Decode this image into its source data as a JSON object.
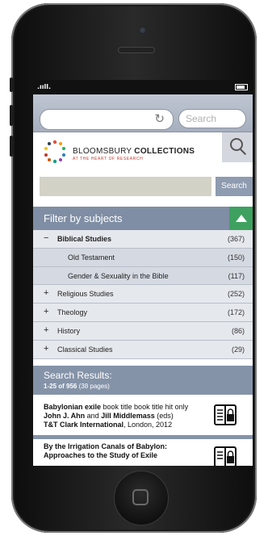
{
  "browser": {
    "search_placeholder": "Search"
  },
  "header": {
    "logo_name_plain": "BLOOMSBURY ",
    "logo_name_bold": "COLLECTIONS",
    "logo_tagline": "AT THE HEART OF RESEARCH",
    "search_button": "Search"
  },
  "filter": {
    "title": "Filter by subjects",
    "subjects": [
      {
        "sign": "−",
        "name": "Biblical Studies",
        "count": "(367)"
      },
      {
        "sign": "",
        "name": "Old Testament",
        "count": "(150)"
      },
      {
        "sign": "",
        "name": "Gender & Sexuality in the Bible",
        "count": "(117)"
      },
      {
        "sign": "+",
        "name": "Religious Studies",
        "count": "(252)"
      },
      {
        "sign": "+",
        "name": "Theology",
        "count": "(172)"
      },
      {
        "sign": "+",
        "name": "History",
        "count": "(86)"
      },
      {
        "sign": "+",
        "name": "Classical Studies",
        "count": "(29)"
      }
    ]
  },
  "results": {
    "title": "Search Results:",
    "range": "1-25 of 956",
    "pages": " (38 pages)",
    "items": [
      {
        "title_bold": "Babylonian exile",
        "title_rest": " book title book title hit only",
        "author1": "John J. Ahn",
        "and": " and ",
        "author2": "Jill Middlemass",
        "eds": " (eds)",
        "publisher": "T&T Clark International",
        "pub_rest": ", London, 2012"
      },
      {
        "title_line1": "By the Irrigation Canals of Babylon:",
        "title_line2": "Approaches to the Study of Exile"
      }
    ]
  },
  "colors": {
    "filter_header": "#7f8ea4",
    "collapse_button": "#3ea160",
    "search_button": "#8e9bb0"
  }
}
